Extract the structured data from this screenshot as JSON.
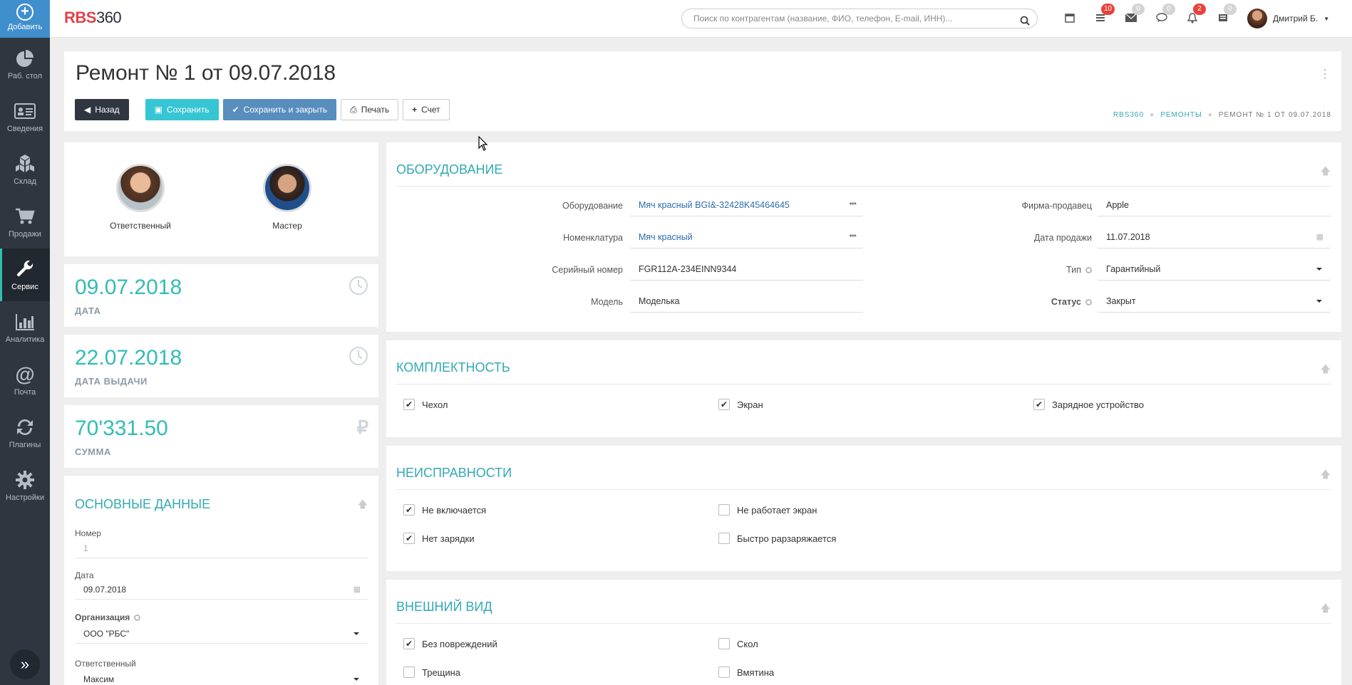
{
  "sidebar": {
    "add_label": "Добавить",
    "items": [
      {
        "label": "Раб. стол",
        "icon": "pie-chart-icon"
      },
      {
        "label": "Сведения",
        "icon": "id-card-icon"
      },
      {
        "label": "Склад",
        "icon": "cubes-icon"
      },
      {
        "label": "Продажи",
        "icon": "cart-icon"
      },
      {
        "label": "Сервис",
        "icon": "wrench-icon",
        "active": true
      },
      {
        "label": "Аналитика",
        "icon": "bar-chart-icon"
      },
      {
        "label": "Почта",
        "icon": "at-icon"
      },
      {
        "label": "Плагины",
        "icon": "refresh-icon"
      },
      {
        "label": "Настройки",
        "icon": "gear-icon"
      }
    ]
  },
  "topbar": {
    "logo_red": "RBS",
    "logo_dark": "360",
    "search_placeholder": "Поиск по контрагентам (название, ФИО, телефон, E-mail, ИНН)...",
    "badges": {
      "tasks": "10",
      "mail": "0",
      "chat": "0",
      "notifications": "2",
      "docs": "0"
    },
    "user_name": "Дмитрий Б."
  },
  "header": {
    "title": "Ремонт № 1 от 09.07.2018",
    "buttons": {
      "back": "Назад",
      "save": "Сохранить",
      "save_close": "Сохранить и закрыть",
      "print": "Печать",
      "invoice": "Счет"
    },
    "breadcrumbs": [
      "RBS360",
      "РЕМОНТЫ",
      "РЕМОНТ № 1 ОТ 09.07.2018"
    ]
  },
  "persons": {
    "responsible": "Ответственный",
    "master": "Мастер"
  },
  "stats": {
    "date": {
      "value": "09.07.2018",
      "caption": "ДАТА"
    },
    "issue_date": {
      "value": "22.07.2018",
      "caption": "ДАТА ВЫДАЧИ"
    },
    "sum": {
      "value": "70'331.50",
      "caption": "СУММА"
    }
  },
  "basic": {
    "title": "ОСНОВНЫЕ ДАННЫЕ",
    "number_label": "Номер",
    "number_value": "1",
    "date_label": "Дата",
    "date_value": "09.07.2018",
    "org_label": "Организация",
    "org_value": "ООО \"РБС\"",
    "responsible_label": "Ответственный",
    "responsible_value": "Максим"
  },
  "equipment": {
    "title": "ОБОРУДОВАНИЕ",
    "equipment_label": "Оборудование",
    "equipment_value": "Мяч красный BGI&-32428K45464645",
    "nomenclature_label": "Номенклатура",
    "nomenclature_value": "Мяч красный",
    "serial_label": "Серийный номер",
    "serial_value": "FGR112A-234EINN9344",
    "model_label": "Модель",
    "model_value": "Моделька",
    "seller_label": "Фирма-продавец",
    "seller_value": "Apple",
    "sale_date_label": "Дата продажи",
    "sale_date_value": "11.07.2018",
    "type_label": "Тип",
    "type_value": "Гарантийный",
    "status_label": "Статус",
    "status_value": "Закрыт"
  },
  "completeness": {
    "title": "КОМПЛЕКТНОСТЬ",
    "items": [
      {
        "label": "Чехол",
        "checked": true
      },
      {
        "label": "Экран",
        "checked": true
      },
      {
        "label": "Зарядное устройство",
        "checked": true
      }
    ]
  },
  "faults": {
    "title": "НЕИСПРАВНОСТИ",
    "items": [
      {
        "label": "Не включается",
        "checked": true
      },
      {
        "label": "Не работает экран",
        "checked": false
      },
      {
        "label": "Нет зарядки",
        "checked": true
      },
      {
        "label": "Быстро рарзаряжается",
        "checked": false
      }
    ]
  },
  "appearance": {
    "title": "ВНЕШНИЙ ВИД",
    "items": [
      {
        "label": "Без повреждений",
        "checked": true
      },
      {
        "label": "Скол",
        "checked": false
      },
      {
        "label": "Трещина",
        "checked": false
      },
      {
        "label": "Вмятина",
        "checked": false
      }
    ]
  },
  "colors": {
    "accent": "#32bdb3",
    "sidebar": "#2f3640",
    "primary_blue": "#578ebe",
    "save_teal": "#36c6d3",
    "badge_red": "#e9423c"
  }
}
